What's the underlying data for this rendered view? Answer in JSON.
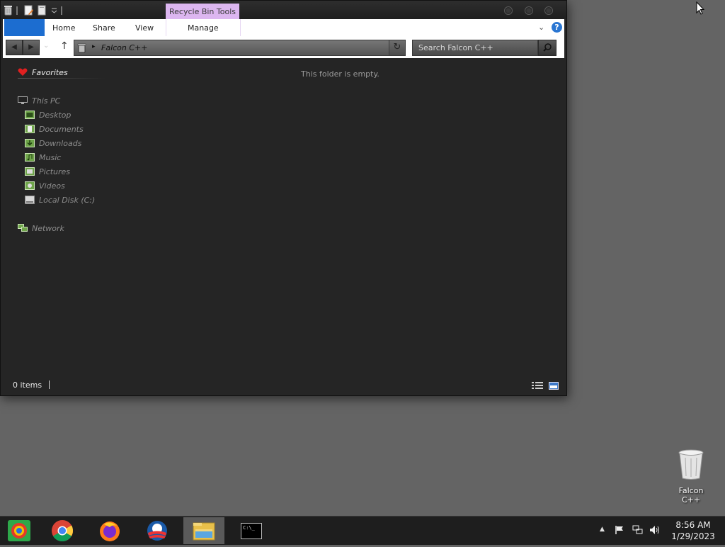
{
  "window": {
    "context_tab": "Recycle Bin Tools",
    "ribbon_tabs": [
      "Home",
      "Share",
      "View",
      "Manage"
    ],
    "help": "?",
    "address": "Falcon C++",
    "search_placeholder": "Search Falcon C++",
    "empty_message": "This folder is empty.",
    "status_count": "0 items"
  },
  "nav_pane": {
    "favorites": "Favorites",
    "this_pc": "This PC",
    "items": [
      "Desktop",
      "Documents",
      "Downloads",
      "Music",
      "Pictures",
      "Videos",
      "Local Disk (C:)"
    ],
    "network": "Network"
  },
  "desktop": {
    "recycle_bin_label": "Falcon C++"
  },
  "taskbar": {
    "apps": [
      "falcon-cpp-icon",
      "chrome-icon",
      "firefox-icon",
      "obama-logo-icon",
      "file-explorer-icon",
      "cmd-icon"
    ],
    "cmd_prompt_text": "C:\\_",
    "time": "8:56 AM",
    "date": "1/29/2023"
  },
  "colors": {
    "window_bg": "#252525",
    "desktop_bg": "#646464",
    "context_tab": "#dcb6f0",
    "file_tab": "#1c6dd0",
    "taskbar_bg": "#1e1e1e"
  }
}
